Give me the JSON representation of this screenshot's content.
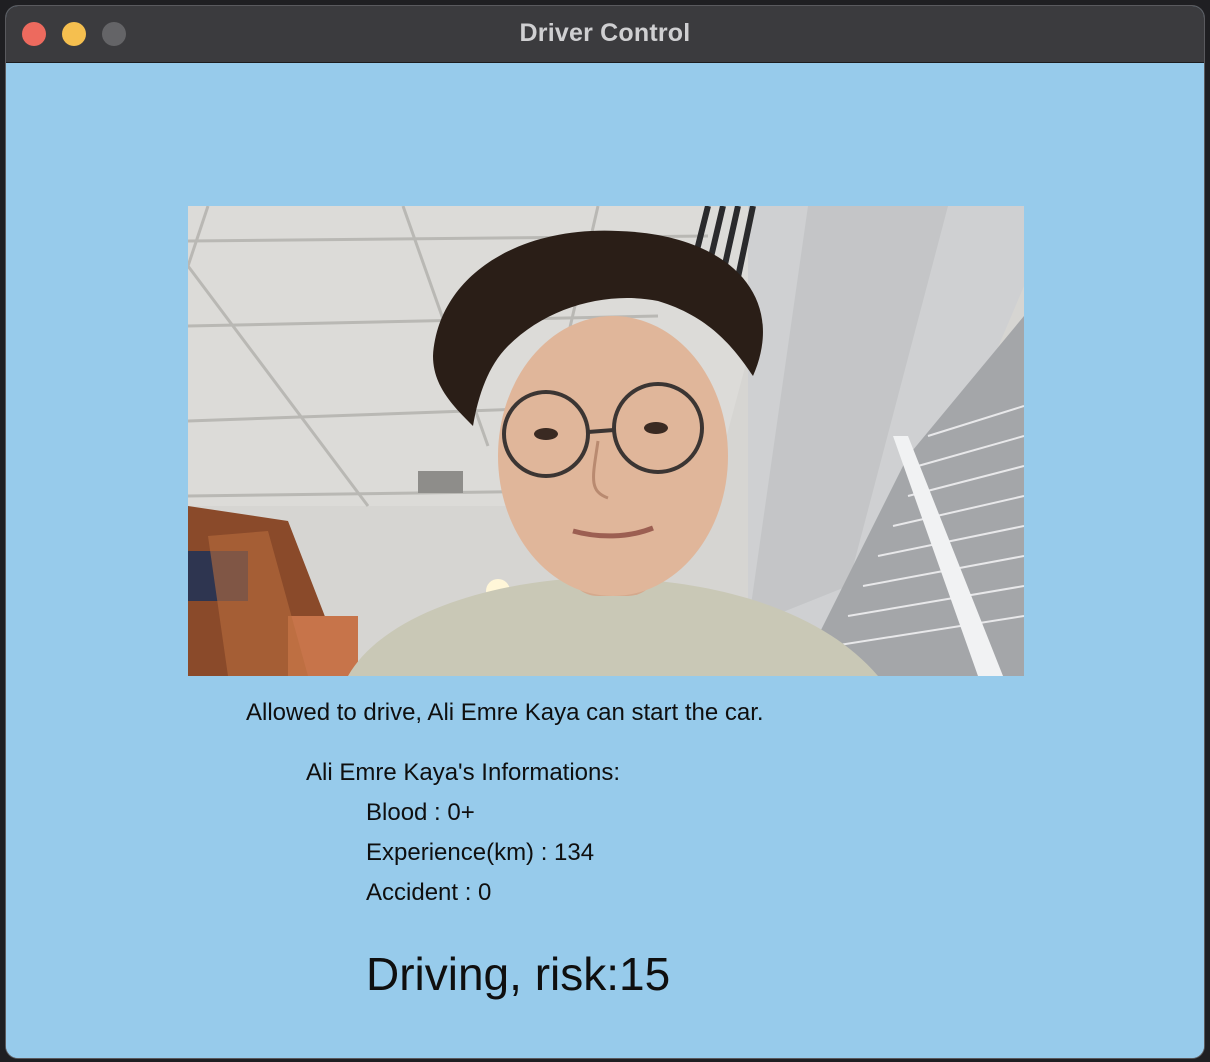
{
  "window": {
    "title": "Driver Control"
  },
  "camera": {
    "content": "driver-face-photo"
  },
  "status": {
    "message": "Allowed to drive, Ali Emre Kaya can start the car."
  },
  "driver_info": {
    "header": "Ali Emre Kaya's Informations:",
    "blood": "Blood : 0+",
    "experience": "Experience(km) : 134",
    "accident": "Accident : 0"
  },
  "risk": {
    "label": "Driving, risk:15"
  },
  "colors": {
    "background": "#97cbeb",
    "titlebar": "#3b3b3e",
    "close": "#ed6a5e",
    "minimize": "#f5bf4f",
    "zoom": "#646467"
  }
}
